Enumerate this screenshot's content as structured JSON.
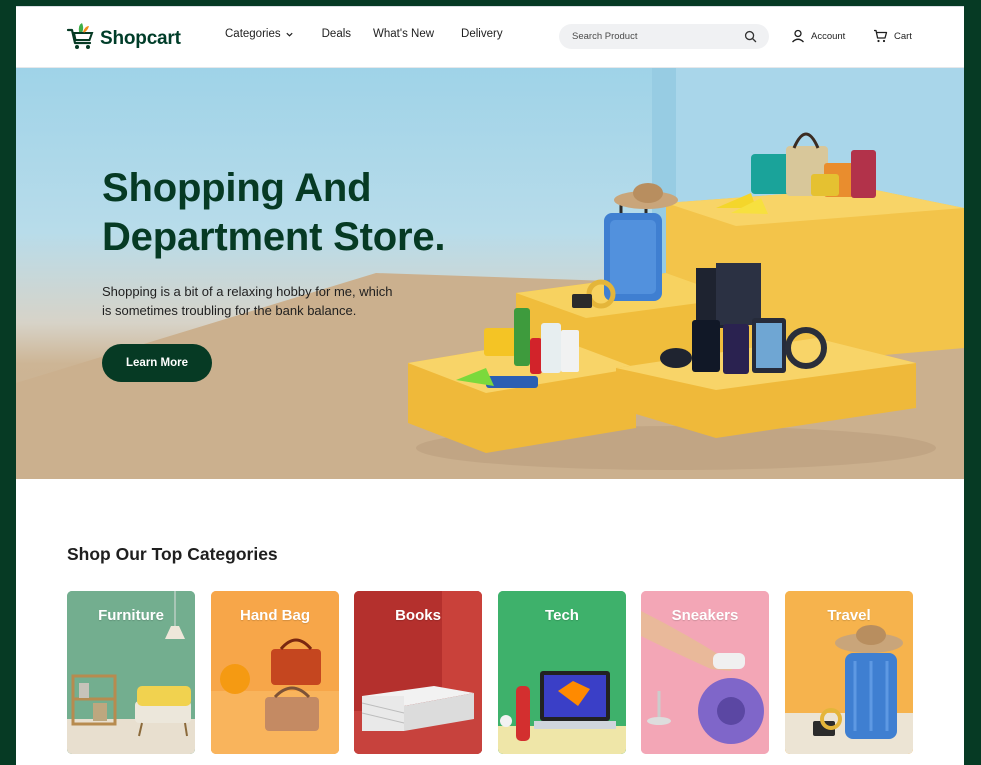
{
  "brand": {
    "name": "Shopcart",
    "logo_icon": "cart-logo-icon"
  },
  "nav": {
    "items": [
      {
        "label": "Categories",
        "has_dropdown": true
      },
      {
        "label": "Deals"
      },
      {
        "label": "What's New"
      },
      {
        "label": "Delivery"
      }
    ]
  },
  "search": {
    "placeholder": "Search Product",
    "value": "",
    "icon": "search-icon"
  },
  "account": {
    "label": "Account",
    "icon": "user-icon"
  },
  "cart": {
    "label": "Cart",
    "icon": "cart-icon"
  },
  "hero": {
    "title_line1": "Shopping And",
    "title_line2": "Department Store.",
    "subtitle_line1": "Shopping is a bit of a relaxing hobby for me, which",
    "subtitle_line2": "is sometimes troubling for the bank balance.",
    "cta_label": "Learn More"
  },
  "categories": {
    "title": "Shop Our Top Categories",
    "items": [
      {
        "label": "Furniture",
        "bg": "#6aa98a"
      },
      {
        "label": "Hand Bag",
        "bg": "#f7a646"
      },
      {
        "label": "Books",
        "bg": "#b8322f"
      },
      {
        "label": "Tech",
        "bg": "#3fb16a"
      },
      {
        "label": "Sneakers",
        "bg": "#f4a6b8"
      },
      {
        "label": "Travel",
        "bg": "#f5b24c"
      }
    ]
  },
  "colors": {
    "brand_green": "#063a24",
    "page_bg": "#063a24"
  }
}
